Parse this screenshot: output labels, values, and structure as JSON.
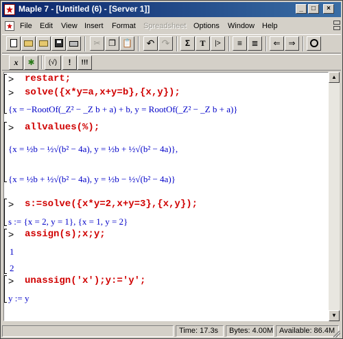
{
  "window": {
    "title": "Maple 7  - [Untitled (6) - [Server 1]]"
  },
  "title_buttons": {
    "minimize": "_",
    "maximize": "□",
    "close": "×"
  },
  "menu": {
    "items": [
      "File",
      "Edit",
      "View",
      "Insert",
      "Format",
      "Spreadsheet",
      "Options",
      "Window",
      "Help"
    ],
    "disabled": [
      "Spreadsheet"
    ]
  },
  "toolbar": {
    "sigma": "Σ",
    "text": "T",
    "exec": "|>",
    "left_arrow": "⇐",
    "right_arrow": "⇒"
  },
  "context_toolbar": {
    "x_btn": "x",
    "maple_btn": "✱",
    "sqrt_btn": "(√)",
    "bang_btn": "!",
    "triple_bang_btn": "!!!"
  },
  "worksheet": {
    "prompt": ">",
    "cmd1": "restart;",
    "cmd2": "solve({x*y=a,x+y=b},{x,y});",
    "out2": "{x = −RootOf(_Z² − _Z b + a) + b, y = RootOf(_Z² − _Z b + a)}",
    "cmd3": "allvalues(%);",
    "out3a": "{x = ½b − ½√(b² − 4a), y = ½b + ½√(b² − 4a)},",
    "out3b": "{x = ½b + ½√(b² − 4a), y = ½b − ½√(b² − 4a)}",
    "cmd4": "s:=solve({x*y=2,x+y=3},{x,y});",
    "out4": "s := {x = 2, y = 1}, {x = 1, y = 2}",
    "cmd5": "assign(s);x;y;",
    "out5a": "1",
    "out5b": "2",
    "cmd6": "unassign('x');y:='y';",
    "out6": "y := y"
  },
  "status": {
    "time": "Time:  17.3s",
    "bytes": "Bytes: 4.00M",
    "available": "Available: 86.4M"
  }
}
